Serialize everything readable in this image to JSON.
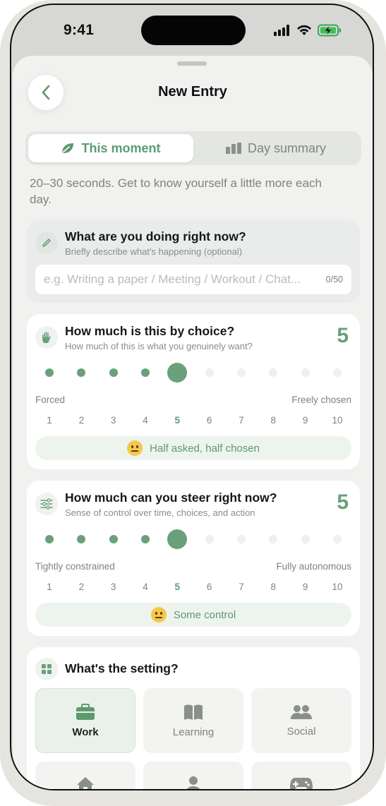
{
  "status": {
    "time": "9:41"
  },
  "header": {
    "title": "New Entry"
  },
  "segments": [
    {
      "label": "This moment",
      "icon": "leaf-icon",
      "active": true
    },
    {
      "label": "Day summary",
      "icon": "bar-chart-icon",
      "active": false
    }
  ],
  "intro": "20–30 seconds. Get to know yourself a little more each day.",
  "doing": {
    "title": "What are you doing right now?",
    "subtitle": "Briefly describe what's happening (optional)",
    "placeholder": "e.g. Writing a paper / Meeting / Workout / Chat...",
    "counter": "0/50"
  },
  "choice": {
    "title": "How much is this by choice?",
    "subtitle": "How much of this is what you genuinely want?",
    "score": "5",
    "value": 5,
    "min_label": "Forced",
    "max_label": "Freely chosen",
    "scale": [
      "1",
      "2",
      "3",
      "4",
      "5",
      "6",
      "7",
      "8",
      "9",
      "10"
    ],
    "verdict": "Half asked, half chosen"
  },
  "steer": {
    "title": "How much can you steer right now?",
    "subtitle": "Sense of control over time, choices, and action",
    "score": "5",
    "value": 5,
    "min_label": "Tightly constrained",
    "max_label": "Fully autonomous",
    "scale": [
      "1",
      "2",
      "3",
      "4",
      "5",
      "6",
      "7",
      "8",
      "9",
      "10"
    ],
    "verdict": "Some control"
  },
  "setting": {
    "title": "What's the setting?",
    "tiles": [
      {
        "label": "Work",
        "icon": "briefcase-icon",
        "active": true
      },
      {
        "label": "Learning",
        "icon": "book-icon",
        "active": false
      },
      {
        "label": "Social",
        "icon": "people-icon",
        "active": false
      },
      {
        "label": "",
        "icon": "home-icon",
        "active": false
      },
      {
        "label": "",
        "icon": "person-icon",
        "active": false
      },
      {
        "label": "",
        "icon": "gamepad-icon",
        "active": false
      }
    ]
  },
  "colors": {
    "accent": "#68a07a",
    "sheet": "#f1f2f0",
    "card": "#ffffff"
  }
}
